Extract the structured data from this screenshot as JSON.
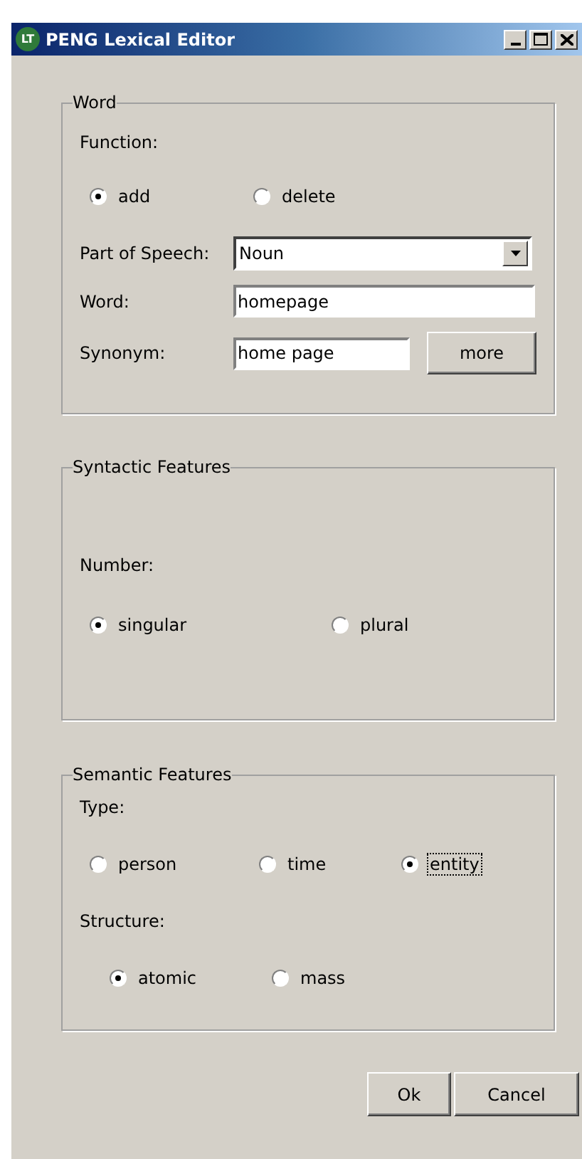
{
  "window": {
    "title": "PENG Lexical Editor",
    "logo": "LT"
  },
  "word_group": {
    "legend": "Word",
    "function_label": "Function:",
    "function_options": [
      {
        "label": "add",
        "selected": true
      },
      {
        "label": "delete",
        "selected": false
      }
    ],
    "part_of_speech_label": "Part of Speech:",
    "part_of_speech_value": "Noun",
    "word_label": "Word:",
    "word_value": "homepage",
    "synonym_label": "Synonym:",
    "synonym_value": "home page",
    "more_button": "more"
  },
  "syntactic_group": {
    "legend": "Syntactic Features",
    "number_label": "Number:",
    "number_options": [
      {
        "label": "singular",
        "selected": true
      },
      {
        "label": "plural",
        "selected": false
      }
    ]
  },
  "semantic_group": {
    "legend": "Semantic Features",
    "type_label": "Type:",
    "type_options": [
      {
        "label": "person",
        "selected": false
      },
      {
        "label": "time",
        "selected": false
      },
      {
        "label": "entity",
        "selected": true,
        "focused": true
      }
    ],
    "structure_label": "Structure:",
    "structure_options": [
      {
        "label": "atomic",
        "selected": true
      },
      {
        "label": "mass",
        "selected": false
      }
    ]
  },
  "buttons": [
    "Ok",
    "Cancel"
  ]
}
